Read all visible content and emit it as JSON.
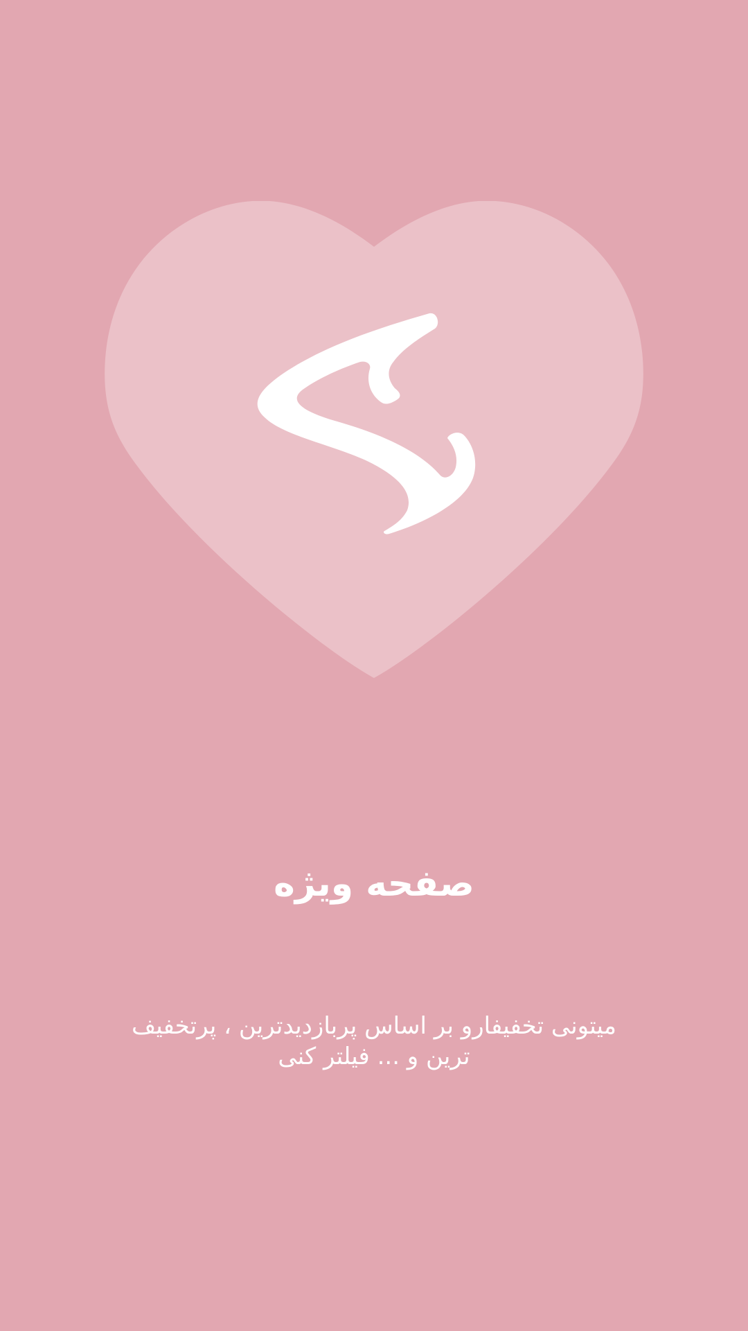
{
  "onboarding": {
    "title": "صفحه ویژه",
    "description": "میتونی تخفیفارو بر اساس پربازدیدترین ، پرتخفیف ترین و ... فیلتر کنی"
  },
  "icons": {
    "heart": "heart-icon",
    "logo": "app-logo-icon"
  },
  "colors": {
    "background": "#e2a7b1",
    "heart": "#ebc1c8",
    "text": "#ffffff"
  }
}
